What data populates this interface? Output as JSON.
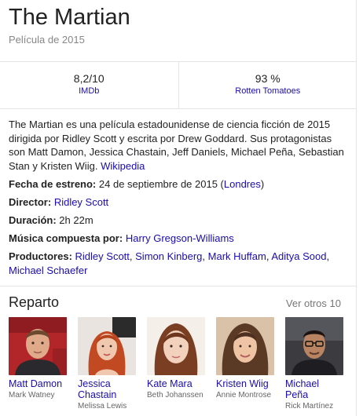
{
  "movie": {
    "title": "The Martian",
    "subtitle": "Película de 2015"
  },
  "ratings": [
    {
      "value": "8,2/10",
      "source": "IMDb"
    },
    {
      "value": "93 %",
      "source": "Rotten Tomatoes"
    }
  ],
  "description": {
    "text": "The Martian es una película estadounidense de ciencia ficción de 2015 dirigida por Ridley Scott y escrita por Drew Goddard. Sus protagonistas son Matt Damon, Jessica Chastain, Jeff Daniels, Michael Peña, Sebastian Stan y Kristen Wiig.",
    "source_link": "Wikipedia"
  },
  "facts": {
    "release": {
      "label": "Fecha de estreno:",
      "value": "24 de septiembre de 2015 (",
      "link": "Londres",
      "suffix": ")"
    },
    "director": {
      "label": "Director:",
      "link": "Ridley Scott"
    },
    "duration": {
      "label": "Duración:",
      "value": "2h 22m"
    },
    "music": {
      "label": "Música compuesta por:",
      "link": "Harry Gregson-Williams"
    },
    "producers": {
      "label": "Productores:",
      "links": [
        "Ridley Scott",
        "Simon Kinberg",
        "Mark Huffam",
        "Aditya Sood",
        "Michael Schaefer"
      ],
      "separator": ", "
    }
  },
  "cast": {
    "title": "Reparto",
    "more": "Ver otros 10",
    "members": [
      {
        "name": "Matt Damon",
        "role": "Mark Watney"
      },
      {
        "name": "Jessica Chastain",
        "role": "Melissa Lewis"
      },
      {
        "name": "Kate Mara",
        "role": "Beth Johanssen"
      },
      {
        "name": "Kristen Wiig",
        "role": "Annie Montrose"
      },
      {
        "name": "Michael Peña",
        "role": "Rick Martínez"
      }
    ]
  },
  "colors": {
    "link": "#1a0dab",
    "text": "#222222",
    "muted": "#878787",
    "divider": "#e5e5e5"
  }
}
